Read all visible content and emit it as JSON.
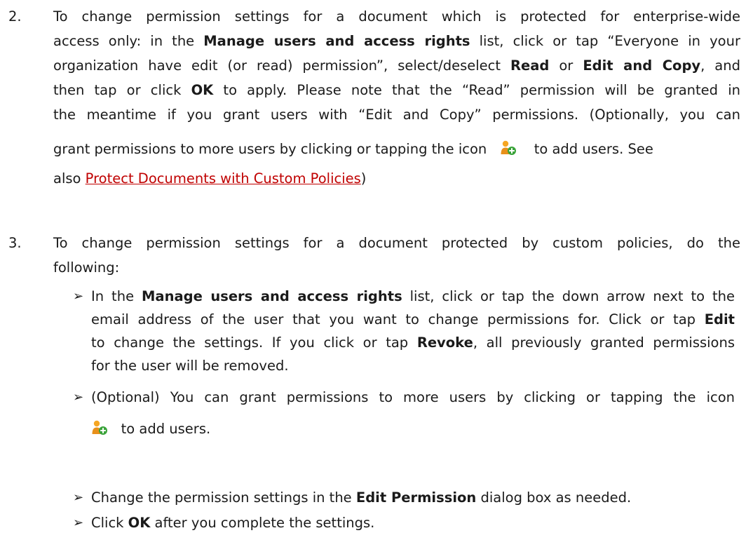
{
  "items": [
    {
      "number": "2.",
      "lines": {
        "l1": "To change permission settings for a document which is protected for enterprise-wide",
        "l2a": "access only: in the ",
        "l2b": "Manage users and access rights",
        "l2c": " list, click or tap “Everyone in your",
        "l3a": "organization have edit (or read) permission”, select/deselect ",
        "l3b": "Read",
        "l3c": " or ",
        "l3d": "Edit and Copy",
        "l3e": ", and",
        "l4a": "then tap or click ",
        "l4b": "OK",
        "l4c": " to apply. Please note that the “Read” permission will be granted in",
        "l5": "the meantime if you grant users with “Edit and Copy” permissions. (Optionally, you can",
        "l6a": "grant permissions to more users by clicking or tapping the icon",
        "l6b": "to add users. See",
        "l7a": "also ",
        "l7link": "Protect Documents with Custom Policies",
        "l7b": ")"
      }
    },
    {
      "number": "3.",
      "lines": {
        "l1": "To change permission settings for a document protected by custom policies, do the",
        "l2": "following:"
      },
      "bullet": "➢",
      "subitems": {
        "s1": {
          "l1a": "In the ",
          "l1b": "Manage users and access rights",
          "l1c": " list, click or tap the down arrow next to the",
          "l2a": "email address of the user that you want to change permissions for. Click or tap ",
          "l2b": "Edit",
          "l3a": "to change the settings. If you click or tap ",
          "l3b": "Revoke",
          "l3c": ", all previously granted permissions",
          "l4": "for the user will be removed."
        },
        "s2": {
          "l1": "(Optional) You can grant permissions to more users by clicking or tapping the icon",
          "l2": "to add users."
        },
        "s3": {
          "l1a": "Change the permission settings in the ",
          "l1b": "Edit Permission",
          "l1c": " dialog box as needed."
        },
        "s4": {
          "l1a": "Click ",
          "l1b": "OK",
          "l1c": " after you complete the settings."
        }
      }
    }
  ],
  "icons": {
    "add_user": "add-user-icon"
  }
}
